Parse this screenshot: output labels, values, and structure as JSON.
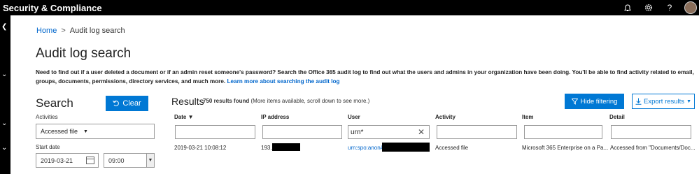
{
  "app": {
    "title": "Security & Compliance"
  },
  "topbar": {
    "icons": [
      "bell-icon",
      "gear-icon",
      "help-icon"
    ],
    "help_glyph": "?"
  },
  "breadcrumb": {
    "home": "Home",
    "separator": ">",
    "current": "Audit log search"
  },
  "page": {
    "title": "Audit log search",
    "description": "Need to find out if a user deleted a document or if an admin reset someone's password? Search the Office 365 audit log to find out what the users and admins in your organization have been doing. You'll be able to find activity related to email, groups, documents, permissions, directory services, and much more.",
    "learn_more": "Learn more about searching the audit log"
  },
  "search": {
    "title": "Search",
    "clear_label": "Clear",
    "activities_label": "Activities",
    "activities_value": "Accessed file",
    "start_date_label": "Start date",
    "start_date_value": "2019-03-21",
    "start_time_value": "09:00"
  },
  "results": {
    "title": "Results",
    "count": "750 results found",
    "note": "(More items available, scroll down to see more.)",
    "hide_filtering_label": "Hide filtering",
    "export_label": "Export results",
    "columns": [
      "Date",
      "IP address",
      "User",
      "Activity",
      "Item",
      "Detail"
    ],
    "filters": {
      "user": "urn*"
    },
    "rows": [
      {
        "date": "2019-03-21 10:08:12",
        "ip": "193.",
        "user": "urn:spo:anon#",
        "activity": "Accessed file",
        "item": "Microsoft 365 Enterprise on a Pa...",
        "detail": "Accessed from \"Documents/Doc..."
      }
    ]
  },
  "colors": {
    "accent": "#0078d4",
    "topbar": "#000000",
    "link": "#0066cc"
  }
}
